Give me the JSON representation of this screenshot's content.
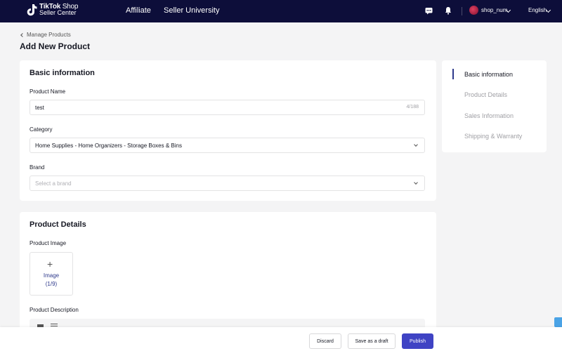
{
  "topnav": {
    "brand_line1": "TikTok",
    "brand_line1b": "Shop",
    "brand_line2": "Seller Center",
    "links": [
      "Affiliate",
      "Seller University"
    ],
    "username": "shop_num",
    "language": "English"
  },
  "header": {
    "breadcrumb": "Manage Products",
    "title": "Add New Product"
  },
  "basic": {
    "title": "Basic information",
    "product_name_label": "Product Name",
    "product_name_value": "test",
    "product_name_count": "4/188",
    "category_label": "Category",
    "category_value": "Home Supplies - Home Organizers - Storage Boxes & Bins",
    "brand_label": "Brand",
    "brand_placeholder": "Select a brand"
  },
  "details": {
    "title": "Product Details",
    "image_label": "Product Image",
    "image_button_label": "Image",
    "image_count": "(1/9)",
    "description_label": "Product Description"
  },
  "sidenav": {
    "items": [
      "Basic information",
      "Product Details",
      "Sales Information",
      "Shipping & Warranty"
    ],
    "active_index": 0
  },
  "actions": {
    "discard": "Discard",
    "save_draft": "Save as a draft",
    "publish": "Publish"
  },
  "colors": {
    "nav_bg": "#0d0e3a",
    "accent": "#3f43c4",
    "active_indicator": "#2f3a8c"
  }
}
